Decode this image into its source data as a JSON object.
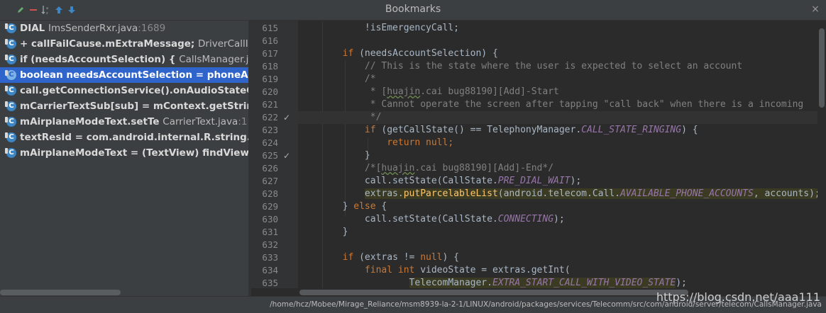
{
  "window": {
    "title": "Bookmarks",
    "close_glyph": "×"
  },
  "toolbar": {
    "icons": [
      {
        "name": "edit-icon",
        "color": "#6aab73"
      },
      {
        "name": "remove-icon",
        "color": "#d25252"
      },
      {
        "name": "sort-alpha-icon",
        "color": "#9aa7b0"
      },
      {
        "name": "move-up-icon",
        "color": "#3d86c6"
      },
      {
        "name": "move-down-icon",
        "color": "#3d86c6"
      }
    ]
  },
  "bookmarks": [
    {
      "icon": "C",
      "code": "DIAL ",
      "file": "ImsSenderRxr.java",
      "line": ":1689",
      "selected": false
    },
    {
      "icon": "C",
      "code": "+ callFailCause.mExtraMessage; ",
      "file": "DriverCallIms",
      "line": "",
      "selected": false
    },
    {
      "icon": "C",
      "code": "if (needsAccountSelection) { ",
      "file": "CallsManager.java",
      "line": "",
      "selected": false
    },
    {
      "icon": "C",
      "code": "boolean needsAccountSelection = phoneAccountHandle == null",
      "file": "",
      "line": "",
      "selected": true
    },
    {
      "icon": "C",
      "code": "call.getConnectionService().onAudioStateChanged",
      "file": "",
      "line": "",
      "selected": false
    },
    {
      "icon": "C",
      "code": "mCarrierTextSub[sub] = mContext.getString",
      "file": "",
      "line": "",
      "selected": false
    },
    {
      "icon": "C",
      "code": "mAirplaneModeText.setTe ",
      "file": "CarrierText.java",
      "line": ":1",
      "selected": false
    },
    {
      "icon": "C",
      "code": "textResId = com.android.internal.R.string.lockscreen",
      "file": "",
      "line": "",
      "selected": false
    },
    {
      "icon": "C",
      "code": "        mAirplaneModeText = (TextView) findViewById",
      "file": "",
      "line": "",
      "selected": false
    }
  ],
  "editor": {
    "lines": [
      {
        "n": "615",
        "mark": "",
        "current": false,
        "segs": [
          {
            "t": "            !isEmergencyCall;"
          }
        ]
      },
      {
        "n": "616",
        "mark": "",
        "current": false,
        "segs": [
          {
            "t": ""
          }
        ]
      },
      {
        "n": "617",
        "mark": "",
        "current": false,
        "segs": [
          {
            "t": "        "
          },
          {
            "t": "if",
            "c": "kw"
          },
          {
            "t": " (needsAccountSelection) {"
          }
        ]
      },
      {
        "n": "618",
        "mark": "",
        "current": false,
        "segs": [
          {
            "t": "            "
          },
          {
            "t": "// This is the state where the user is expected to select an account",
            "c": "cm"
          }
        ]
      },
      {
        "n": "619",
        "mark": "",
        "current": false,
        "segs": [
          {
            "t": "            "
          },
          {
            "t": "/*",
            "c": "cm"
          }
        ]
      },
      {
        "n": "620",
        "mark": "",
        "current": false,
        "segs": [
          {
            "t": "             "
          },
          {
            "t": "* [",
            "c": "cm"
          },
          {
            "t": "huajin",
            "c": "cm ul"
          },
          {
            "t": ".cai bug88190][Add]-Start",
            "c": "cm"
          }
        ]
      },
      {
        "n": "621",
        "mark": "",
        "current": false,
        "segs": [
          {
            "t": "             "
          },
          {
            "t": "* Cannot operate the screen after tapping \"call back\" when there is a incoming",
            "c": "cm"
          }
        ]
      },
      {
        "n": "622",
        "mark": "✓",
        "current": true,
        "segs": [
          {
            "t": "             "
          },
          {
            "t": "*/",
            "c": "cm"
          }
        ]
      },
      {
        "n": "623",
        "mark": "",
        "current": false,
        "segs": [
          {
            "t": "            "
          },
          {
            "t": "if",
            "c": "kw"
          },
          {
            "t": " (getCallState() == TelephonyManager."
          },
          {
            "t": "CALL_STATE_RINGING",
            "c": "cst"
          },
          {
            "t": ") {"
          }
        ]
      },
      {
        "n": "624",
        "mark": "",
        "current": false,
        "segs": [
          {
            "t": "                "
          },
          {
            "t": "return null",
            "c": "kw"
          },
          {
            "t": ";",
            "c": "kw"
          }
        ]
      },
      {
        "n": "625",
        "mark": "✓",
        "current": false,
        "segs": [
          {
            "t": "            }"
          }
        ]
      },
      {
        "n": "626",
        "mark": "",
        "current": false,
        "segs": [
          {
            "t": "            "
          },
          {
            "t": "/*[",
            "c": "cm"
          },
          {
            "t": "huajin",
            "c": "cm ul"
          },
          {
            "t": ".cai bug88190][Add]-End*/",
            "c": "cm"
          }
        ]
      },
      {
        "n": "627",
        "mark": "",
        "current": false,
        "segs": [
          {
            "t": "            call.setState(CallState."
          },
          {
            "t": "PRE_DIAL_WAIT",
            "c": "cst"
          },
          {
            "t": ");"
          }
        ]
      },
      {
        "n": "628",
        "mark": "",
        "current": false,
        "segs": [
          {
            "t": "            "
          },
          {
            "t": "extras.",
            "c": "hl"
          },
          {
            "t": "putParcelableList",
            "c": "hl fn"
          },
          {
            "t": "(android.telecom.Call.",
            "c": "hl"
          },
          {
            "t": "AVAILABLE_PHONE_ACCOUNTS",
            "c": "hl cst"
          },
          {
            "t": ", accounts);",
            "c": "hl"
          }
        ]
      },
      {
        "n": "629",
        "mark": "",
        "current": false,
        "segs": [
          {
            "t": "        } "
          },
          {
            "t": "else",
            "c": "kw"
          },
          {
            "t": " {"
          }
        ]
      },
      {
        "n": "630",
        "mark": "",
        "current": false,
        "segs": [
          {
            "t": "            call.setState(CallState."
          },
          {
            "t": "CONNECTING",
            "c": "cst"
          },
          {
            "t": ");"
          }
        ]
      },
      {
        "n": "631",
        "mark": "",
        "current": false,
        "segs": [
          {
            "t": "        }"
          }
        ]
      },
      {
        "n": "632",
        "mark": "",
        "current": false,
        "segs": [
          {
            "t": ""
          }
        ]
      },
      {
        "n": "633",
        "mark": "",
        "current": false,
        "segs": [
          {
            "t": "        "
          },
          {
            "t": "if",
            "c": "kw"
          },
          {
            "t": " (extras != "
          },
          {
            "t": "null",
            "c": "kw"
          },
          {
            "t": ") {"
          }
        ]
      },
      {
        "n": "634",
        "mark": "",
        "current": false,
        "segs": [
          {
            "t": "            "
          },
          {
            "t": "final int",
            "c": "kw"
          },
          {
            "t": " videoState = extras.getInt("
          }
        ]
      },
      {
        "n": "635",
        "mark": "",
        "current": false,
        "segs": [
          {
            "t": "                    "
          },
          {
            "t": "TelecomManager.",
            "c": "hl"
          },
          {
            "t": "EXTRA_START_CALL_WITH_VIDEO_STATE",
            "c": "hl cst"
          },
          {
            "t": ");"
          }
        ]
      }
    ]
  },
  "status": {
    "path": "/home/hcz/Mobee/Mirage_Reliance/msm8939-la-2-1/LINUX/android/packages/services/Telecomm/src/com/android/server/telecom/CallsManager.java"
  },
  "watermark": "https://blog.csdn.net/aaa111"
}
